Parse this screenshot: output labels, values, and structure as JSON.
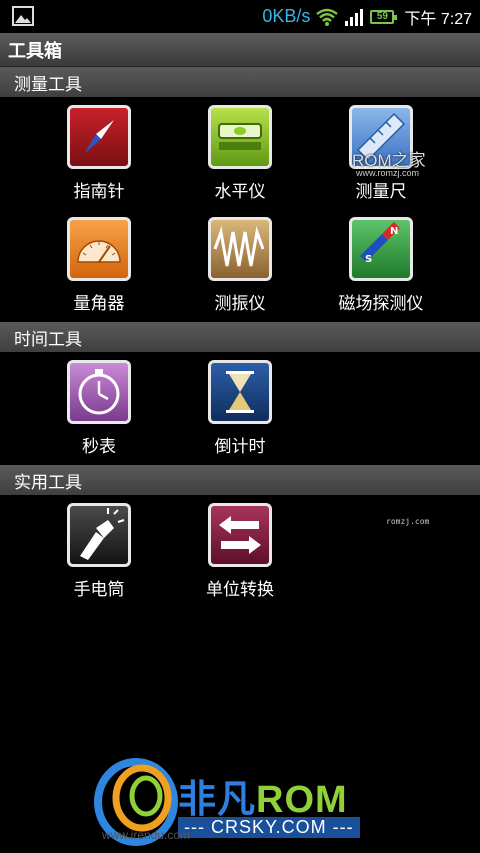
{
  "status_bar": {
    "network_speed": "0KB/s",
    "battery_level": "59",
    "time": "下午 7:27",
    "icons": [
      "gallery-icon",
      "wifi-icon",
      "signal-icon",
      "battery-icon"
    ],
    "accent": "#35b5e5"
  },
  "titlebar": {
    "title": "工具箱"
  },
  "sections": [
    {
      "header": "测量工具",
      "items": [
        {
          "label": "指南针",
          "icon": "compass-icon"
        },
        {
          "label": "水平仪",
          "icon": "level-icon"
        },
        {
          "label": "测量尺",
          "icon": "ruler-icon"
        },
        {
          "label": "量角器",
          "icon": "protractor-icon"
        },
        {
          "label": "测振仪",
          "icon": "vibration-icon"
        },
        {
          "label": "磁场探测仪",
          "icon": "magnet-icon"
        }
      ]
    },
    {
      "header": "时间工具",
      "items": [
        {
          "label": "秒表",
          "icon": "stopwatch-icon"
        },
        {
          "label": "倒计时",
          "icon": "hourglass-icon"
        }
      ]
    },
    {
      "header": "实用工具",
      "items": [
        {
          "label": "手电筒",
          "icon": "flashlight-icon"
        },
        {
          "label": "单位转换",
          "icon": "unit-convert-icon"
        }
      ]
    }
  ],
  "watermarks": {
    "rom_logo": "ROM之家",
    "rom_url": "www.romzj.com",
    "small": "romzj.com",
    "banner_cn": "非凡",
    "banner_rom": "ROM",
    "banner_en": "--- CRSKY.COM ---",
    "banner_url": "www.irendu.com"
  }
}
